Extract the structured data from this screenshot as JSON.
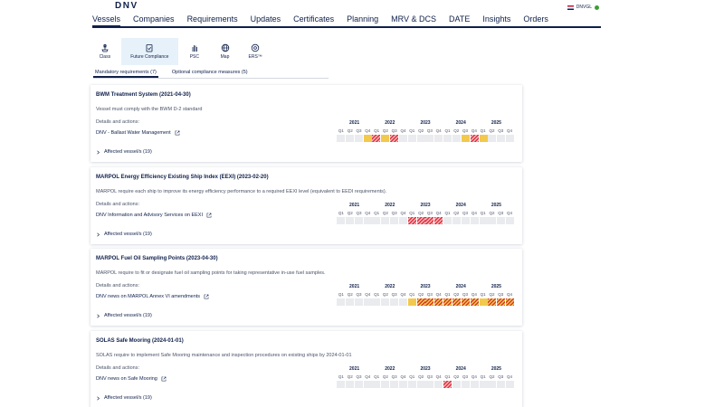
{
  "header": {
    "logo": "DNV",
    "user": "DNVGL"
  },
  "nav": {
    "items": [
      "Vessels",
      "Companies",
      "Requirements",
      "Updates",
      "Certificates",
      "Planning",
      "MRV & DCS",
      "DATE",
      "Insights",
      "Orders"
    ],
    "active_index": 0
  },
  "subnav": {
    "items": [
      {
        "label": "Class",
        "icon": "ship-icon"
      },
      {
        "label": "Future Compliance",
        "icon": "clipboard-check-icon"
      },
      {
        "label": "PSC",
        "icon": "hand-icon"
      },
      {
        "label": "Map",
        "icon": "globe-icon"
      },
      {
        "label": "ERS™",
        "icon": "ers-icon"
      }
    ],
    "active_index": 1
  },
  "tabs": {
    "mandatory": "Mandatory requirements (7)",
    "optional": "Optional compliance measures (5)"
  },
  "timeline": {
    "years": [
      "2021",
      "2022",
      "2023",
      "2024",
      "2025"
    ],
    "quarters": [
      "Q1",
      "Q2",
      "Q3",
      "Q4"
    ]
  },
  "colors": {
    "navy": "#0f204b",
    "yellow": "#f2c94c",
    "red": "#e0303f",
    "empty": "#e9ebee",
    "active_subnav": "#e7f1f9"
  },
  "legend_states": {
    "y": "yellow solid",
    "r": "red hatched",
    "yr": "yellow-red hatched",
    "e": "empty"
  },
  "cards": [
    {
      "title": "BWM Treatment System (2021-04-30)",
      "desc": "Vessel must comply with the BWM D-2 standard",
      "details": "Details and actions:",
      "link": "DNV - Ballast Water Management",
      "affected": "Affected vessel/s (19)",
      "cells": [
        "e",
        "e",
        "e",
        "y",
        "r",
        "y",
        "r",
        "e",
        "e",
        "e",
        "e",
        "e",
        "e",
        "e",
        "y",
        "r",
        "y",
        "e",
        "e",
        "e"
      ]
    },
    {
      "title": "MARPOL Energy Efficiency Existing Ship Index (EEXI) (2023-02-20)",
      "desc": "MARPOL require each ship to improve its energy efficiency performance to a required EEXI level (equivalent to EEDI requirements).",
      "details": "Details and actions:",
      "link": "DNV Information and Advisory Services on EEXI",
      "affected": "Affected vessel/s (19)",
      "cells": [
        "e",
        "e",
        "e",
        "e",
        "e",
        "e",
        "e",
        "e",
        "r",
        "r",
        "r",
        "r",
        "e",
        "e",
        "e",
        "e",
        "e",
        "e",
        "e",
        "e"
      ]
    },
    {
      "title": "MARPOL Fuel Oil Sampling Points (2023-04-30)",
      "desc": "MARPOL require to fit or designate fuel oil sampling points for taking representative in-use fuel samples.",
      "details": "Details and actions:",
      "link": "DNV news on MARPOL Annex VI amendments",
      "affected": "Affected vessel/s (19)",
      "cells": [
        "e",
        "e",
        "e",
        "e",
        "e",
        "e",
        "e",
        "e",
        "y",
        "yr",
        "yr",
        "yr",
        "yr",
        "yr",
        "yr",
        "yr",
        "y",
        "yr",
        "yr",
        "yr"
      ]
    },
    {
      "title": "SOLAS Safe Mooring (2024-01-01)",
      "desc": "SOLAS require to implement Safe Mooring maintenance and inspection procedures on existing ships by 2024-01-01",
      "details": "Details and actions:",
      "link": "DNV news on Safe Mooring",
      "affected": "Affected vessel/s (19)",
      "cells": [
        "e",
        "e",
        "e",
        "e",
        "e",
        "e",
        "e",
        "e",
        "e",
        "e",
        "e",
        "e",
        "r",
        "e",
        "e",
        "e",
        "e",
        "e",
        "e",
        "e"
      ]
    }
  ]
}
